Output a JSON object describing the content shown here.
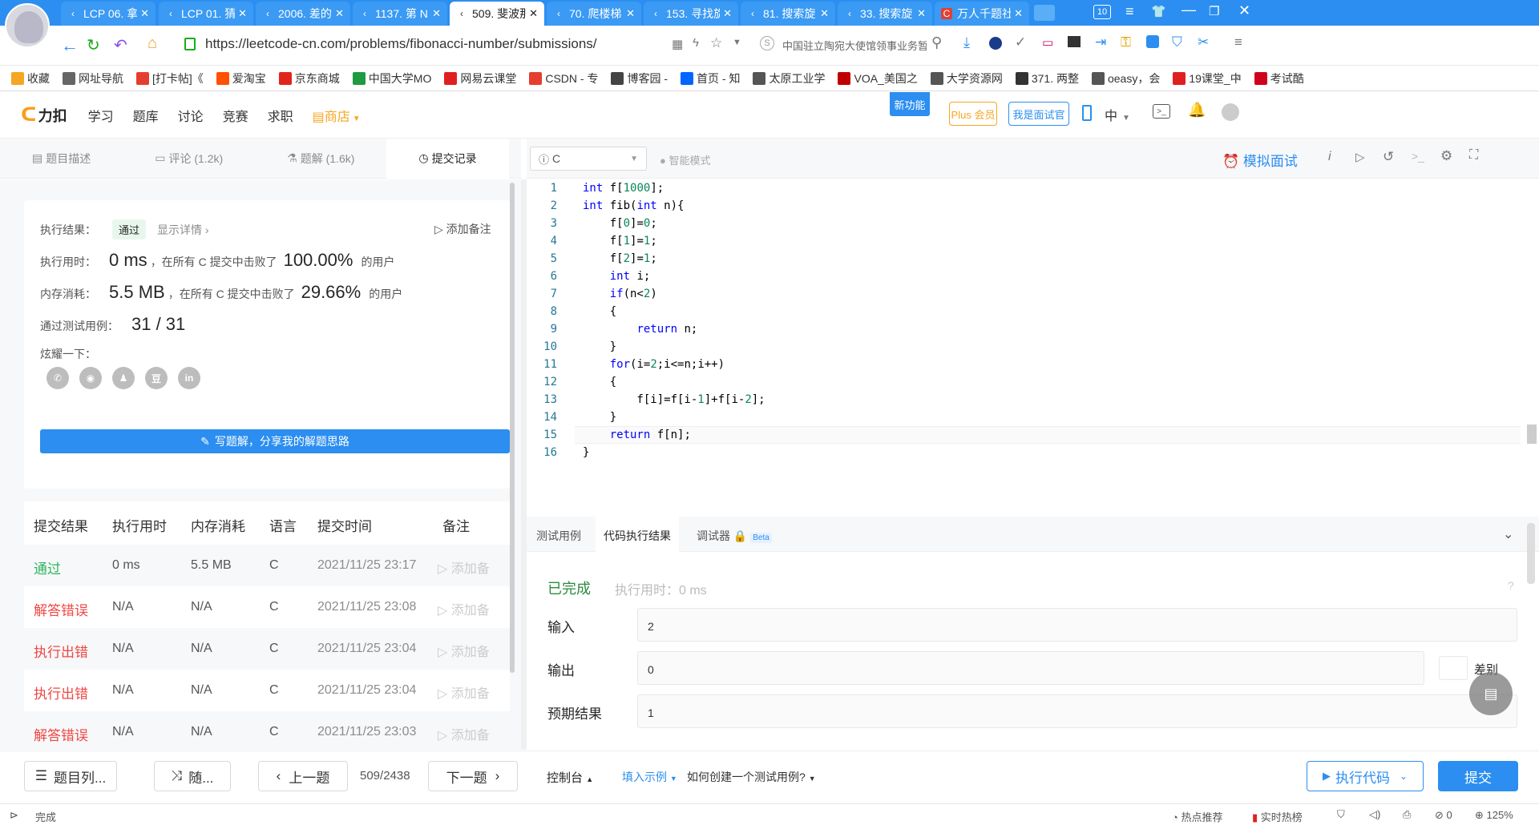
{
  "browser": {
    "tabs": [
      {
        "icon": "leetcode-icon",
        "label": "LCP 06. 拿"
      },
      {
        "icon": "leetcode-icon",
        "label": "LCP 01. 猜"
      },
      {
        "icon": "leetcode-icon",
        "label": "2006. 差的"
      },
      {
        "icon": "leetcode-icon",
        "label": "1137. 第 N"
      },
      {
        "icon": "leetcode-icon",
        "label": "509. 斐波那"
      },
      {
        "icon": "leetcode-icon",
        "label": "70. 爬楼梯"
      },
      {
        "icon": "leetcode-icon",
        "label": "153. 寻找旋"
      },
      {
        "icon": "leetcode-icon",
        "label": "81. 搜索旋"
      },
      {
        "icon": "leetcode-icon",
        "label": "33. 搜索旋"
      },
      {
        "icon": "csdn-icon",
        "label": "万人千题社"
      }
    ],
    "tab_count": "10",
    "url": "https://leetcode-cn.com/problems/fibonacci-number/submissions/",
    "search_placeholder": "中国驻立陶宛大使馆领事业务暂停",
    "bookmarks": [
      {
        "icon": "star-icon",
        "label": "收藏",
        "color": "#f5a623"
      },
      {
        "icon": "globe-icon",
        "label": "网址导航",
        "color": "#666666"
      },
      {
        "icon": "csdn-icon",
        "label": "[打卡帖]《",
        "color": "#e53e30"
      },
      {
        "icon": "taobao-icon",
        "label": "爱淘宝",
        "color": "#ff5000"
      },
      {
        "icon": "jd-icon",
        "label": "京东商城",
        "color": "#e1251b"
      },
      {
        "icon": "mooc-icon",
        "label": "中国大学MO",
        "color": "#1e9b3f"
      },
      {
        "icon": "netease-icon",
        "label": "网易云课堂",
        "color": "#e02020"
      },
      {
        "icon": "csdn-icon",
        "label": "CSDN - 专",
        "color": "#e53e30"
      },
      {
        "icon": "cnblogs-icon",
        "label": "博客园 -",
        "color": "#444444"
      },
      {
        "icon": "zhihu-icon",
        "label": "首页 - 知",
        "color": "#0066ff"
      },
      {
        "icon": "doc-icon",
        "label": "太原工业学",
        "color": "#555555"
      },
      {
        "icon": "voa-icon",
        "label": "VOA_美国之",
        "color": "#c00000"
      },
      {
        "icon": "doc-icon",
        "label": "大学资源网",
        "color": "#555555"
      },
      {
        "icon": "leetcode-icon",
        "label": "371. 两整",
        "color": "#333333"
      },
      {
        "icon": "doc-icon",
        "label": "oeasy，会",
        "color": "#555555"
      },
      {
        "icon": "ke19-icon",
        "label": "19课堂_中",
        "color": "#e02020"
      },
      {
        "icon": "kaoshi-icon",
        "label": "考试酷",
        "color": "#d0021b"
      }
    ]
  },
  "site": {
    "logo": "力扣",
    "nav": [
      "学习",
      "题库",
      "讨论",
      "竞赛",
      "求职"
    ],
    "store": "商店",
    "new_feature": "新功能",
    "plus": "Plus 会员",
    "interviewer": "我是面试官",
    "lang": "中"
  },
  "left": {
    "tabs": [
      {
        "icon": "description-icon",
        "label": "题目描述"
      },
      {
        "icon": "comment-icon",
        "label": "评论 (1.2k)"
      },
      {
        "icon": "solution-icon",
        "label": "题解 (1.6k)"
      },
      {
        "icon": "clock-icon",
        "label": "提交记录"
      }
    ],
    "result": {
      "label_result": "执行结果：",
      "status": "通过",
      "details": "显示详情",
      "add_note": "添加备注",
      "label_time": "执行用时：",
      "time_value": "0 ms",
      "time_text": "，在所有 C 提交中击败了",
      "time_percent": "100.00%",
      "users": "的用户",
      "label_mem": "内存消耗：",
      "mem_value": "5.5 MB",
      "mem_text": "，在所有 C 提交中击败了",
      "mem_percent": "29.66%",
      "label_tests": "通过测试用例：",
      "tests_value": "31 / 31",
      "share_label": "炫耀一下：",
      "share_icons": [
        "wechat-icon",
        "weibo-icon",
        "qq-icon",
        "douban-icon",
        "linkedin-icon"
      ],
      "share_glyphs": [
        "✆",
        "◉",
        "♟",
        "豆",
        "in"
      ],
      "write_solution": "写题解，分享我的解题思路"
    },
    "table": {
      "headers": [
        "提交结果",
        "执行用时",
        "内存消耗",
        "语言",
        "提交时间",
        "备注"
      ],
      "rows": [
        {
          "status": "通过",
          "status_color": "#2db55d",
          "time": "0 ms",
          "mem": "5.5 MB",
          "lang": "C",
          "date": "2021/11/25 23:17",
          "note": "添加备"
        },
        {
          "status": "解答错误",
          "status_color": "#ef4743",
          "time": "N/A",
          "mem": "N/A",
          "lang": "C",
          "date": "2021/11/25 23:08",
          "note": "添加备"
        },
        {
          "status": "执行出错",
          "status_color": "#ef4743",
          "time": "N/A",
          "mem": "N/A",
          "lang": "C",
          "date": "2021/11/25 23:04",
          "note": "添加备"
        },
        {
          "status": "执行出错",
          "status_color": "#ef4743",
          "time": "N/A",
          "mem": "N/A",
          "lang": "C",
          "date": "2021/11/25 23:04",
          "note": "添加备"
        },
        {
          "status": "解答错误",
          "status_color": "#ef4743",
          "time": "N/A",
          "mem": "N/A",
          "lang": "C",
          "date": "2021/11/25 23:03",
          "note": "添加备"
        }
      ]
    }
  },
  "editor": {
    "language": "C",
    "smart_mode": "智能模式",
    "mock_interview": "模拟面试",
    "lines": [
      "int f[1000];",
      "int fib(int n){",
      "    f[0]=0;",
      "    f[1]=1;",
      "    f[2]=1;",
      "    int i;",
      "    if(n<2)",
      "    {",
      "        return n;",
      "    }",
      "    for(i=2;i<=n;i++)",
      "    {",
      "        f[i]=f[i-1]+f[i-2];",
      "    }",
      "    return f[n];",
      "}"
    ]
  },
  "console": {
    "tabs": [
      "测试用例",
      "代码执行结果",
      "调试器"
    ],
    "beta": "Beta",
    "status": "已完成",
    "exec_time": "执行用时：0 ms",
    "input_label": "输入",
    "input_value": "2",
    "output_label": "输出",
    "output_value": "0",
    "diff": "差别",
    "expected_label": "预期结果",
    "expected_value": "1"
  },
  "bottom": {
    "problem_list": "题目列...",
    "random": "随...",
    "prev": "上一题",
    "counter": "509/2438",
    "next": "下一题",
    "console": "控制台",
    "fill_example": "填入示例",
    "how_to": "如何创建一个测试用例?",
    "run": "执行代码",
    "submit": "提交"
  },
  "status": {
    "left": "完成",
    "hot": "热点推荐",
    "realtime": "实时热榜",
    "zero": "0",
    "zoom": "125%"
  },
  "colors": {
    "tabbar": "#2b8ef0",
    "accent": "#007aff",
    "success": "#2db55d",
    "error": "#ef4743"
  }
}
